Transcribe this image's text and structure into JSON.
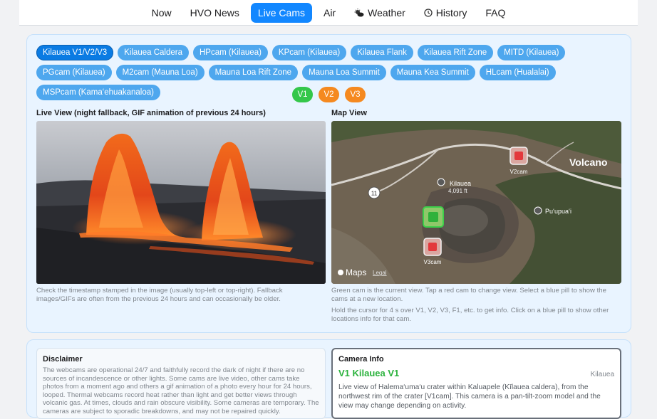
{
  "nav": {
    "items": [
      {
        "label": "Now",
        "icon": "",
        "active": false
      },
      {
        "label": "HVO News",
        "icon": "",
        "active": false
      },
      {
        "label": "Live Cams",
        "icon": "",
        "active": true
      },
      {
        "label": "Air",
        "icon": "",
        "active": false
      },
      {
        "label": "Weather",
        "icon": "cloud-sun-icon",
        "active": false
      },
      {
        "label": "History",
        "icon": "clock-icon",
        "active": false
      },
      {
        "label": "FAQ",
        "icon": "",
        "active": false
      }
    ]
  },
  "pills": [
    "Kilauea V1/V2/V3",
    "Kilauea Caldera",
    "HPcam (Kilauea)",
    "KPcam (Kilauea)",
    "Kilauea Flank",
    "Kilauea Rift Zone",
    "MITD (Kilauea)",
    "PGcam (Kilauea)",
    "M2cam (Mauna Loa)",
    "Mauna Loa Rift Zone",
    "Mauna Loa Summit",
    "Mauna Kea Summit",
    "HLcam (Hualalai)",
    "MSPcam (Kama‘ehuakanaloa)"
  ],
  "view_buttons": [
    "V1",
    "V2",
    "V3"
  ],
  "live_view": {
    "title": "Live View (night fallback, GIF animation of previous 24 hours)",
    "note": "Check the timestamp stamped in the image (usually top-left or top-right). Fallback images/GIFs are often from the previous 24 hours and can occasionally be older."
  },
  "map_view": {
    "title": "Map View",
    "labels": {
      "volcano": "Volcano",
      "kilauea": "Kilauea",
      "elevation": "4,091 ft",
      "puupuai": "Pu‘upua‘i",
      "v2cam": "V2cam",
      "v3cam": "V3cam",
      "route": "11",
      "maps": "Maps",
      "legal": "Legal"
    },
    "note1": "Green cam is the current view. Tap a red cam to change view. Select a blue pill to show the cams at a new location.",
    "note2": "Hold the cursor for 4 s over V1, V2, V3, F1, etc. to get info. Click on a blue pill to show other locations info for that cam."
  },
  "disclaimer": {
    "title": "Disclaimer",
    "text": "The webcams are operational 24/7 and faithfully record the dark of night if there are no sources of incandescence or other lights. Some cams are live video, other cams take photos from a moment ago and others a gif animation of a photo every hour for 24 hours, looped. Thermal webcams record heat rather than light and get better views through volcanic gas. At times, clouds and rain obscure visibility. Some cameras are temporary. The cameras are subject to sporadic breakdowns, and may not be repaired quickly."
  },
  "camera_info": {
    "title": "Camera Info",
    "cam_title": "V1  Kilauea V1",
    "region": "Kilauea",
    "description": "Live view of Halema‘uma‘u crater within Kaluapele (Kīlauea caldera), from the northwest rim of the crater [V1cam]. This camera is a pan-tilt-zoom model and the view may change depending on activity."
  }
}
